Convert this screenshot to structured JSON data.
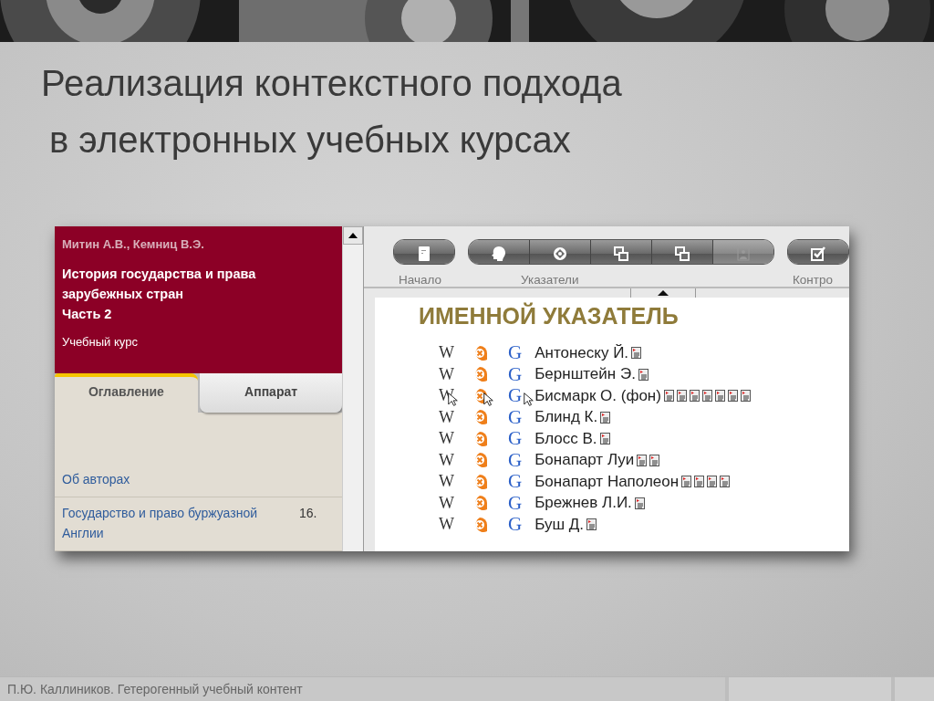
{
  "banner": {
    "kind": "picture"
  },
  "slide_title": [
    "Реализация контекстного подхода",
    "в электронных учебных курсах"
  ],
  "course": {
    "authors": "Митин А.В., Кемниц В.Э.",
    "title": [
      "История государства и права",
      "зарубежных стран",
      "Часть 2"
    ],
    "subtitle": "Учебный курс",
    "tabs": [
      {
        "label": "Оглавление",
        "selected": true
      },
      {
        "label": "Аппарат",
        "selected": false
      }
    ],
    "toc": [
      {
        "title": "Об авторах"
      },
      {
        "title": "Государство и право буржуазной Англии",
        "page": "16."
      }
    ]
  },
  "toolbar": {
    "groups": [
      {
        "label": "Начало",
        "buttons": [
          {
            "kind": "book"
          }
        ]
      },
      {
        "label": "Указатели",
        "buttons": [
          {
            "kind": "head"
          },
          {
            "kind": "target"
          },
          {
            "kind": "windows"
          },
          {
            "kind": "windows"
          },
          {
            "kind": "portrait",
            "disabled": true
          }
        ]
      },
      {
        "label": "Контро",
        "buttons": [
          {
            "kind": "check"
          }
        ]
      }
    ]
  },
  "index": {
    "heading": "ИМЕННОЙ УКАЗАТЕЛЬ",
    "rows": [
      {
        "wiki": "W",
        "google": "G",
        "name": "Антонеску Й.",
        "documents": [
          {
            "kind": "page"
          }
        ]
      },
      {
        "wiki": "W",
        "google": "G",
        "name": "Бернштейн Э.",
        "documents": [
          {
            "kind": "page"
          }
        ]
      },
      {
        "wiki": "W",
        "google": "G",
        "name": "Бисмарк О. (фон)",
        "documents": [
          {
            "kind": "page"
          },
          {
            "kind": "page"
          },
          {
            "kind": "page"
          },
          {
            "kind": "page"
          },
          {
            "kind": "page"
          },
          {
            "kind": "page"
          },
          {
            "kind": "page"
          }
        ]
      },
      {
        "wiki": "W",
        "google": "G",
        "name": "Блинд К.",
        "documents": [
          {
            "kind": "page"
          }
        ]
      },
      {
        "wiki": "W",
        "google": "G",
        "name": "Блосс В.",
        "documents": [
          {
            "kind": "page"
          }
        ]
      },
      {
        "wiki": "W",
        "google": "G",
        "name": "Бонапарт Луи",
        "documents": [
          {
            "kind": "page"
          },
          {
            "kind": "page"
          }
        ]
      },
      {
        "wiki": "W",
        "google": "G",
        "name": "Бонапарт Наполеон",
        "documents": [
          {
            "kind": "page"
          },
          {
            "kind": "page"
          },
          {
            "kind": "page"
          },
          {
            "kind": "page"
          }
        ]
      },
      {
        "wiki": "W",
        "google": "G",
        "name": "Брежнев Л.И.",
        "documents": [
          {
            "kind": "page"
          }
        ]
      },
      {
        "wiki": "W",
        "google": "G",
        "name": "Буш Д.",
        "documents": [
          {
            "kind": "page"
          }
        ]
      }
    ]
  },
  "footer": {
    "text": "П.Ю. Каллиников. Гетерогенный учебный контент"
  }
}
